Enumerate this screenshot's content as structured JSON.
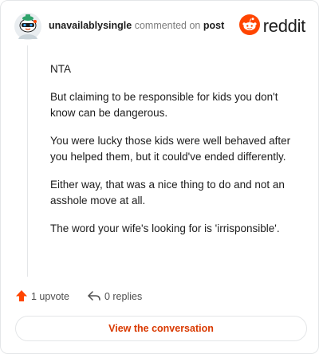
{
  "header": {
    "username": "unavailablysingle",
    "commented_on": "commented on",
    "post_link": "post",
    "brand": "reddit"
  },
  "comment": {
    "paragraphs": [
      "NTA",
      "But claiming to be responsible for kids you don't know can be dangerous.",
      "You were lucky those kids were well behaved after you helped them, but it could've ended differently.",
      "Either way, that was a nice thing to do and not an asshole move at all.",
      "The word your wife's looking for is 'irrisponsible'."
    ]
  },
  "footer": {
    "upvotes": "1 upvote",
    "replies": "0 replies"
  },
  "cta": {
    "label": "View the conversation"
  },
  "colors": {
    "reddit_orange": "#ff4500",
    "cta_text": "#d93900"
  },
  "icons": [
    "snoo-avatar-icon",
    "reddit-logo-icon",
    "upvote-arrow-icon",
    "reply-arrow-icon"
  ]
}
